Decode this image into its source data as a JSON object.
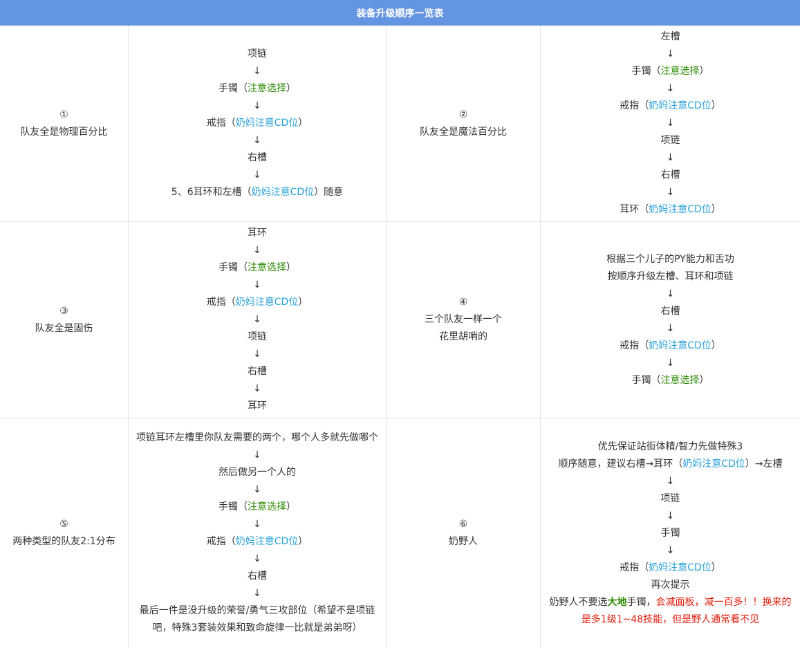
{
  "title": "装备升级顺序一览表",
  "rows": [
    {
      "num": "①",
      "team": "队友全是物理百分比",
      "a": [
        "项链",
        "↓",
        "手镯（",
        "注意选择",
        "）",
        "↓",
        "戒指（",
        "奶妈注意CD位",
        "）",
        "↓",
        "右槽",
        "↓",
        "5、6耳环和左槽（",
        "奶妈注意CD位",
        "）随意"
      ],
      "b_num": "②",
      "b_team": "队友全是魔法百分比",
      "b": [
        "左槽",
        "↓",
        "手镯（",
        "注意选择",
        "）",
        "↓",
        "戒指（",
        "奶妈注意CD位",
        "）",
        "↓",
        "项链",
        "↓",
        "右槽",
        "↓",
        "耳环（",
        "奶妈注意CD位",
        "）"
      ]
    },
    {
      "num": "③",
      "team": "队友全是固伤",
      "a": [
        "耳环",
        "↓",
        "手镯（",
        "注意选择",
        "）",
        "↓",
        "戒指（",
        "奶妈注意CD位",
        "）",
        "↓",
        "项链",
        "↓",
        "右槽",
        "↓",
        "耳环"
      ],
      "b_num": "④",
      "b_team1": "三个队友一样一个",
      "b_team2": "花里胡哨的",
      "b": [
        "根据三个儿子的PY能力和舌功",
        "按顺序升级左槽、耳环和项链",
        "↓",
        "右槽",
        "↓",
        "戒指（",
        "奶妈注意CD位",
        "）",
        "↓",
        "手镯（",
        "注意选择",
        "）"
      ]
    },
    {
      "num": "⑤",
      "team": "两种类型的队友2:1分布",
      "a": [
        "项链耳环左槽里你队友需要的两个，哪个人多就先做哪个",
        "↓",
        "然后做另一个人的",
        "↓",
        "手镯（",
        "注意选择",
        "）",
        "↓",
        "戒指（",
        "奶妈注意CD位",
        "）",
        "↓",
        "右槽",
        "↓",
        "最后一件是没升级的荣誉/勇气三攻部位（希望不是项链吧，特殊3套装效果和致命旋律一比就是弟弟呀）"
      ],
      "b_num": "⑥",
      "b_team": "奶野人",
      "b": [
        "优先保证站街体精/智力先做特殊3",
        "顺序随意，建议右槽→耳环（",
        "奶妈注意CD位",
        "）→左槽",
        "↓",
        "项链",
        "↓",
        "手镯",
        "↓",
        "戒指（",
        "奶妈注意CD位",
        "）",
        "再次提示",
        "奶野人不要选",
        "大地",
        "手镯，",
        "会减面板，减一百多！！换来的是多1级1~48技能，但是野人通常看不见"
      ]
    }
  ]
}
